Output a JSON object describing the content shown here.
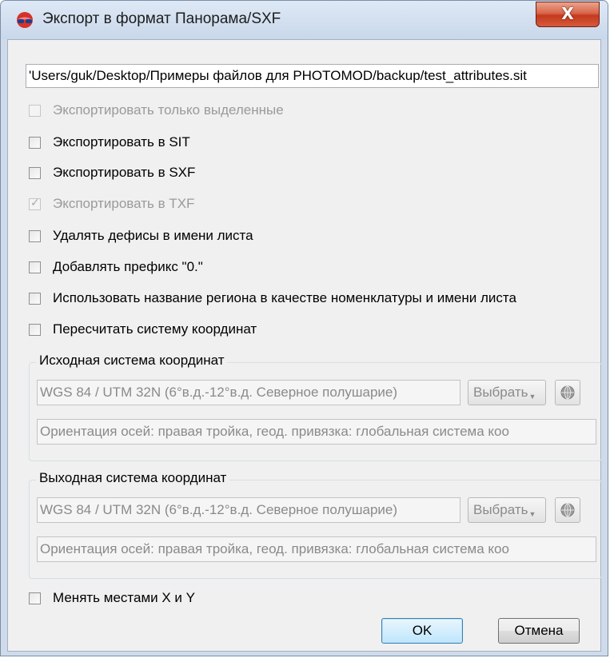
{
  "window": {
    "title": "Экспорт в формат Панорама/SXF",
    "close_label": "X"
  },
  "path": {
    "value": "'Users/guk/Desktop/Примеры файлов для PHOTOMOD/backup/test_attributes.sit"
  },
  "checkboxes": [
    {
      "label": "Экспортировать только выделенные",
      "checked": false,
      "enabled": false
    },
    {
      "label": "Экспортировать в SIT",
      "checked": false,
      "enabled": true
    },
    {
      "label": "Экспортировать в SXF",
      "checked": false,
      "enabled": true
    },
    {
      "label": "Экспортировать в TXF",
      "checked": true,
      "enabled": false
    },
    {
      "label": "Удалять дефисы в имени листа",
      "checked": false,
      "enabled": true
    },
    {
      "label": "Добавлять префикс \"0.\"",
      "checked": false,
      "enabled": true
    },
    {
      "label": "Использовать название региона в качестве номенклатуры и имени листа",
      "checked": false,
      "enabled": true
    },
    {
      "label": "Пересчитать систему координат",
      "checked": false,
      "enabled": true
    }
  ],
  "source_cs": {
    "title": "Исходная система координат",
    "name": "WGS 84 / UTM 32N (6°в.д.-12°в.д. Северное полушарие)",
    "choose_label": "Выбрать",
    "info": "Ориентация осей: правая тройка, геод. привязка: глобальная система коо"
  },
  "target_cs": {
    "title": "Выходная система координат",
    "name": "WGS 84 / UTM 32N (6°в.д.-12°в.д. Северное полушарие)",
    "choose_label": "Выбрать",
    "info": "Ориентация осей: правая тройка, геод. привязка: глобальная система коо"
  },
  "swap_xy": {
    "label": "Менять местами X и Y",
    "checked": false,
    "enabled": true
  },
  "buttons": {
    "ok": "OK",
    "cancel": "Отмена"
  }
}
